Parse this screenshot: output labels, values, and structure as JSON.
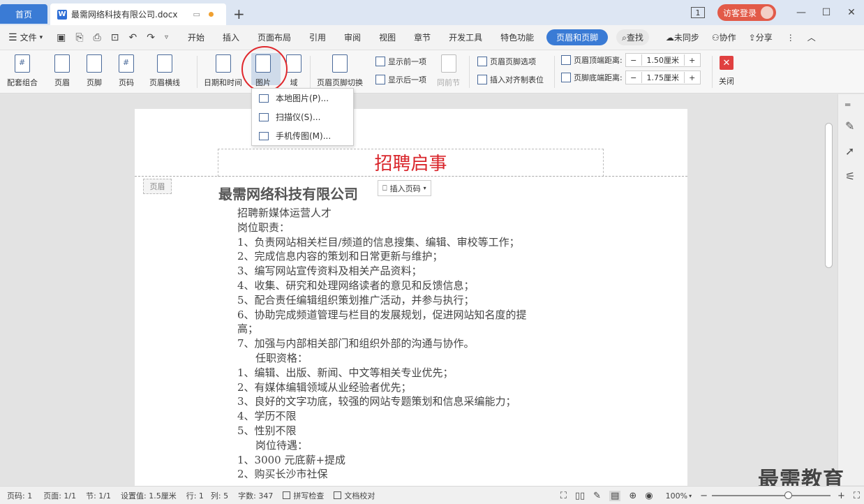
{
  "titlebar": {
    "home_tab": "首页",
    "doc_tab": "最需网络科技有限公司.docx",
    "doc_badge": "W",
    "new_tab_plus": "+",
    "badge_count": "1",
    "login_label": "访客登录",
    "min": "—",
    "max": "☐",
    "close": "✕"
  },
  "menu": {
    "file": "文件",
    "tabs": [
      "开始",
      "插入",
      "页面布局",
      "引用",
      "审阅",
      "视图",
      "章节",
      "开发工具",
      "特色功能"
    ],
    "active_tab": "页眉和页脚",
    "search": "查找",
    "unsync": "未同步",
    "collab": "协作",
    "share": "分享"
  },
  "ribbon": {
    "set_combo": "配套组合",
    "header": "页眉",
    "footer": "页脚",
    "page_num": "页码",
    "header_line": "页眉横线",
    "date_time": "日期和时间",
    "picture": "图片",
    "field": "域",
    "switch": "页眉页脚切换",
    "show_prev": "显示前一项",
    "show_next": "显示后一项",
    "same_prev": "同前节",
    "hf_options": "页眉页脚选项",
    "insert_align_tab": "插入对齐制表位",
    "header_dist_label": "页眉顶端距离:",
    "header_dist_value": "1.50厘米",
    "footer_dist_label": "页脚底端距离:",
    "footer_dist_value": "1.75厘米",
    "close": "关闭",
    "close_x": "✕"
  },
  "dropdown": {
    "items": [
      "本地图片(P)...",
      "扫描仪(S)...",
      "手机传图(M)..."
    ]
  },
  "document": {
    "header_text": "招聘启事",
    "header_tag": "页眉",
    "insert_page_num": "插入页码",
    "company": "最需网络科技有限公司",
    "lines": [
      "招聘新媒体运营人才",
      "岗位职责：",
      "1、负责网站相关栏目/频道的信息搜集、编辑、审校等工作；",
      "2、完成信息内容的策划和日常更新与维护；",
      "3、编写网站宣传资料及相关产品资料；",
      "4、收集、研究和处理网络读者的意见和反馈信息；",
      "5、配合责任编辑组织策划推广活动，并参与执行；",
      "6、协助完成频道管理与栏目的发展规划，促进网站知名度的提",
      "高；",
      "7、加强与内部相关部门和组织外部的沟通与协作。",
      "任职资格：",
      "1、编辑、出版、新闻、中文等相关专业优先；",
      "2、有媒体编辑领域从业经验者优先；",
      "3、良好的文字功底，较强的网站专题策划和信息采编能力；",
      "4、学历不限",
      "5、性别不限",
      "岗位待遇：",
      "1、3000 元底薪+提成",
      "2、购买长沙市社保"
    ]
  },
  "watermark": "最需教育",
  "status": {
    "page_code": "页码: 1",
    "page": "页面: 1/1",
    "section": "节: 1/1",
    "set_value": "设置值: 1.5厘米",
    "row": "行: 1",
    "col": "列: 5",
    "word_count": "字数: 347",
    "spell_check": "拼写检查",
    "doc_check": "文档校对",
    "zoom": "100%",
    "zoom_minus": "−",
    "zoom_plus": "+"
  }
}
